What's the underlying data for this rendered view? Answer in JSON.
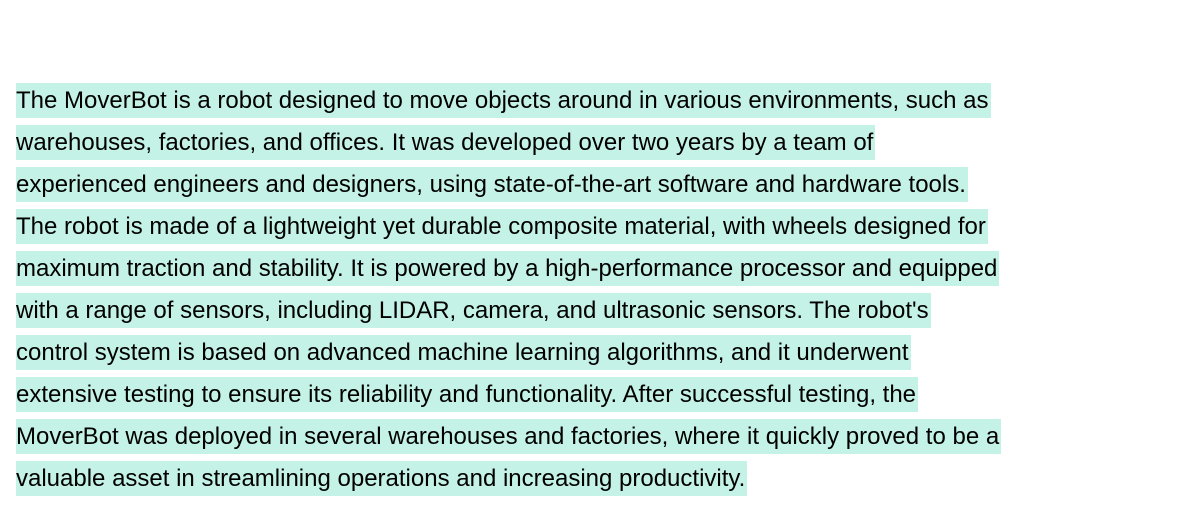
{
  "document": {
    "highlight_color": "#c4f2e6",
    "lines": [
      "The MoverBot is a robot designed to move objects around in various environments, such as",
      "warehouses, factories, and offices. It was developed over two years by a team of",
      "experienced engineers and designers, using state-of-the-art software and hardware tools.",
      "The robot is made of a lightweight yet durable composite material, with wheels designed for",
      "maximum traction and stability. It is powered by a high-performance processor and equipped",
      "with a range of sensors, including LIDAR, camera, and ultrasonic sensors. The robot's",
      "control system is based on advanced machine learning algorithms, and it underwent",
      "extensive testing to ensure its reliability and functionality. After successful testing, the",
      "MoverBot was deployed in several warehouses and factories, where it quickly proved to be a",
      "valuable asset in streamlining operations and increasing productivity."
    ]
  }
}
